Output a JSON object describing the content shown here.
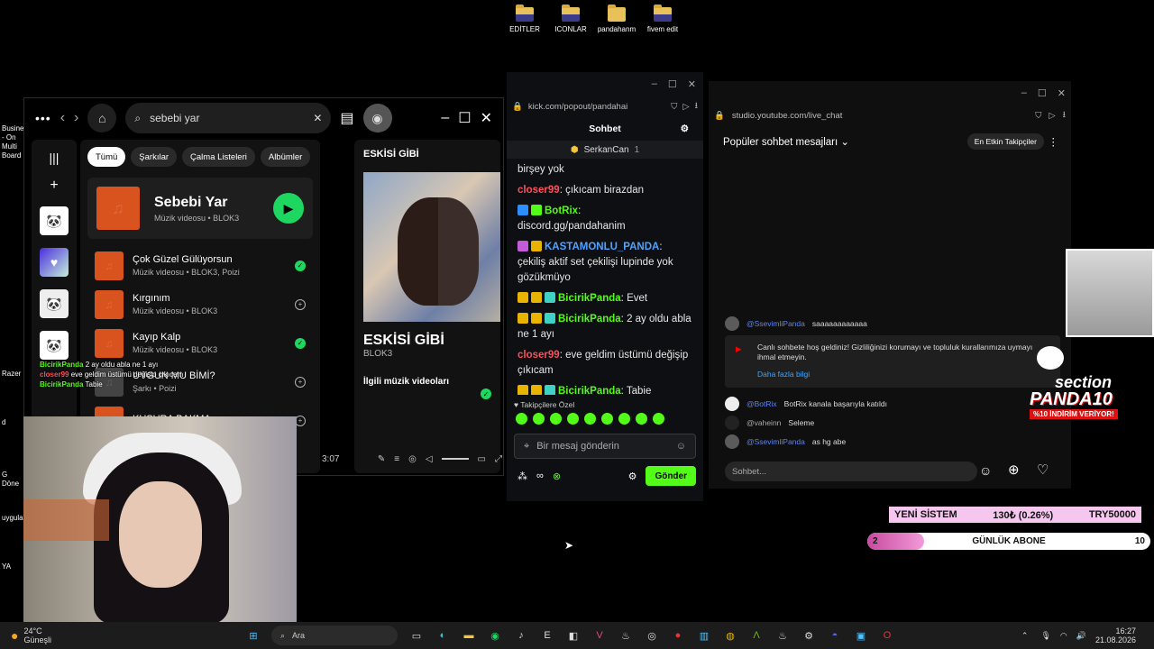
{
  "desktop": {
    "icons": [
      "EDİTLER",
      "ICONLAR",
      "pandahanm",
      "fivem edit"
    ],
    "left_partials": [
      "Busine",
      "- On",
      "Multi",
      "Board",
      "Razer",
      "d",
      "G",
      "Döne",
      "uygula",
      "YA"
    ]
  },
  "spotify": {
    "search_value": "sebebi yar",
    "chips": [
      "Tümü",
      "Şarkılar",
      "Çalma Listeleri",
      "Albümler"
    ],
    "top_result": {
      "title": "Sebebi Yar",
      "subtitle": "Müzik videosu • BLOK3"
    },
    "songs": [
      {
        "title": "Çok Güzel Gülüyorsun",
        "subtitle": "Müzik videosu • BLOK3, Poizi",
        "added": true
      },
      {
        "title": "Kırgınım",
        "subtitle": "Müzik videosu • BLOK3",
        "added": false
      },
      {
        "title": "Kayıp Kalp",
        "subtitle": "Müzik videosu • BLOK3",
        "added": true
      },
      {
        "title": "UYGUN MU BİMİ?",
        "subtitle": "Şarkı • Poizi",
        "added": false
      },
      {
        "title": "KUSURA BAKMA",
        "subtitle": "",
        "added": false
      }
    ],
    "now_playing": {
      "header": "ESKİSİ GİBİ",
      "title": "ESKİSİ GİBİ",
      "artist": "BLOK3",
      "related": "İlgili müzik videoları",
      "time": "3:07"
    }
  },
  "kick": {
    "url": "kick.com/popout/pandahai",
    "title": "Sohbet",
    "pinned_user": "SerkanCan",
    "pinned_count": "1",
    "messages": [
      {
        "user": "",
        "text": "birşey yok",
        "color": "none"
      },
      {
        "user": "closer99",
        "text": "çıkıcam birazdan",
        "color": "red"
      },
      {
        "user": "BotRix",
        "text": "discord.gg/pandahanim",
        "color": "green"
      },
      {
        "user": "KASTAMONLU_PANDA",
        "text": "çekiliş aktif set çekilişi lupinde yok gözükmüyo",
        "color": "blue"
      },
      {
        "user": "BicirikPanda",
        "text": "Evet",
        "color": "green"
      },
      {
        "user": "BicirikPanda",
        "text": "2 ay oldu abla ne 1 ayı",
        "color": "green"
      },
      {
        "user": "closer99",
        "text": "eve geldim üstümü değişip çıkıcam",
        "color": "red"
      },
      {
        "user": "BicirikPanda",
        "text": "Tabie",
        "color": "green"
      }
    ],
    "emotes_label": "Takipçilere Özel",
    "input_placeholder": "Bir mesaj gönderin",
    "send_label": "Gönder",
    "overlay_lines": [
      {
        "user": "BicirikPanda",
        "text": "2 ay oldu abla ne 1 ayı"
      },
      {
        "user": "closer99",
        "text": "eve geldim üstümü değişip çıkıcam"
      },
      {
        "user": "BicirikPanda",
        "text": "Tabie"
      }
    ]
  },
  "youtube": {
    "url": "studio.youtube.com/live_chat",
    "mode": "Popüler sohbet mesajları",
    "top_fans": "En Etkin Takipçiler",
    "messages": [
      {
        "user": "@SsevimliPanda",
        "text": "saaaaaaaaaaaa",
        "mod": true
      },
      {
        "user": "@BotRix",
        "text": "BotRix kanala başarıyla katıldı",
        "mod": true
      },
      {
        "user": "@vaheinn",
        "text": "Seleme",
        "mod": false
      },
      {
        "user": "@SsevimliPanda",
        "text": "as hg abe",
        "mod": true
      }
    ],
    "welcome": "Canlı sohbete hoş geldiniz! Gizliliğinizi korumayı ve topluluk kurallarımıza uymayı ihmal etmeyin.",
    "welcome_link": "Daha fazla bilgi",
    "input_placeholder": "Sohbet..."
  },
  "overlay": {
    "logo_line1": "section",
    "logo_line2": "PANDA10",
    "logo_line3": "%10 İNDİRİM VERİYOR!",
    "system_label": "YENİ SİSTEM",
    "system_amount": "130₺ (0.26%)",
    "system_goal": "TRY50000",
    "sub_label": "GÜNLÜK ABONE",
    "sub_current": "2",
    "sub_goal": "10",
    "sub_progress": 0.2
  },
  "taskbar": {
    "weather_temp": "24°C",
    "weather_desc": "Güneşli",
    "search_label": "Ara",
    "time": "16:27",
    "date": "21.08.2026"
  },
  "colors": {
    "spotify_green": "#1ed760",
    "kick_green": "#53fc18",
    "youtube_blue": "#3ea6ff",
    "overlay_pink": "#f6c7ee"
  }
}
